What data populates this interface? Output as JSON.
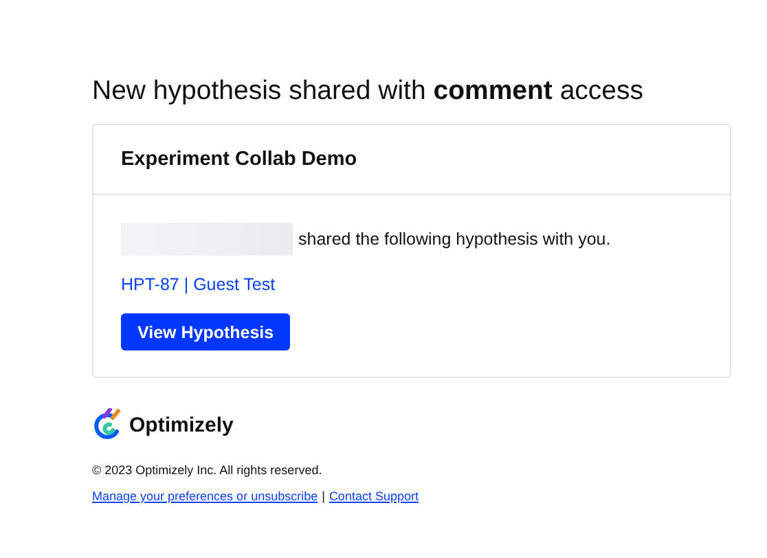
{
  "heading": "New hypothesis shared with **comment** access",
  "card": {
    "title": "Experiment Collab Demo",
    "message": "shared the following hypothesis with you.",
    "hypothesis_link": "HPT-87 | Guest Test",
    "button": "View Hypothesis"
  },
  "footer": {
    "brand": "Optimizely",
    "copyright": "© 2023 Optimizely Inc. All rights reserved.",
    "links": [
      "Manage your preferences or unsubscribe",
      "Contact Support"
    ],
    "separator": "|"
  }
}
